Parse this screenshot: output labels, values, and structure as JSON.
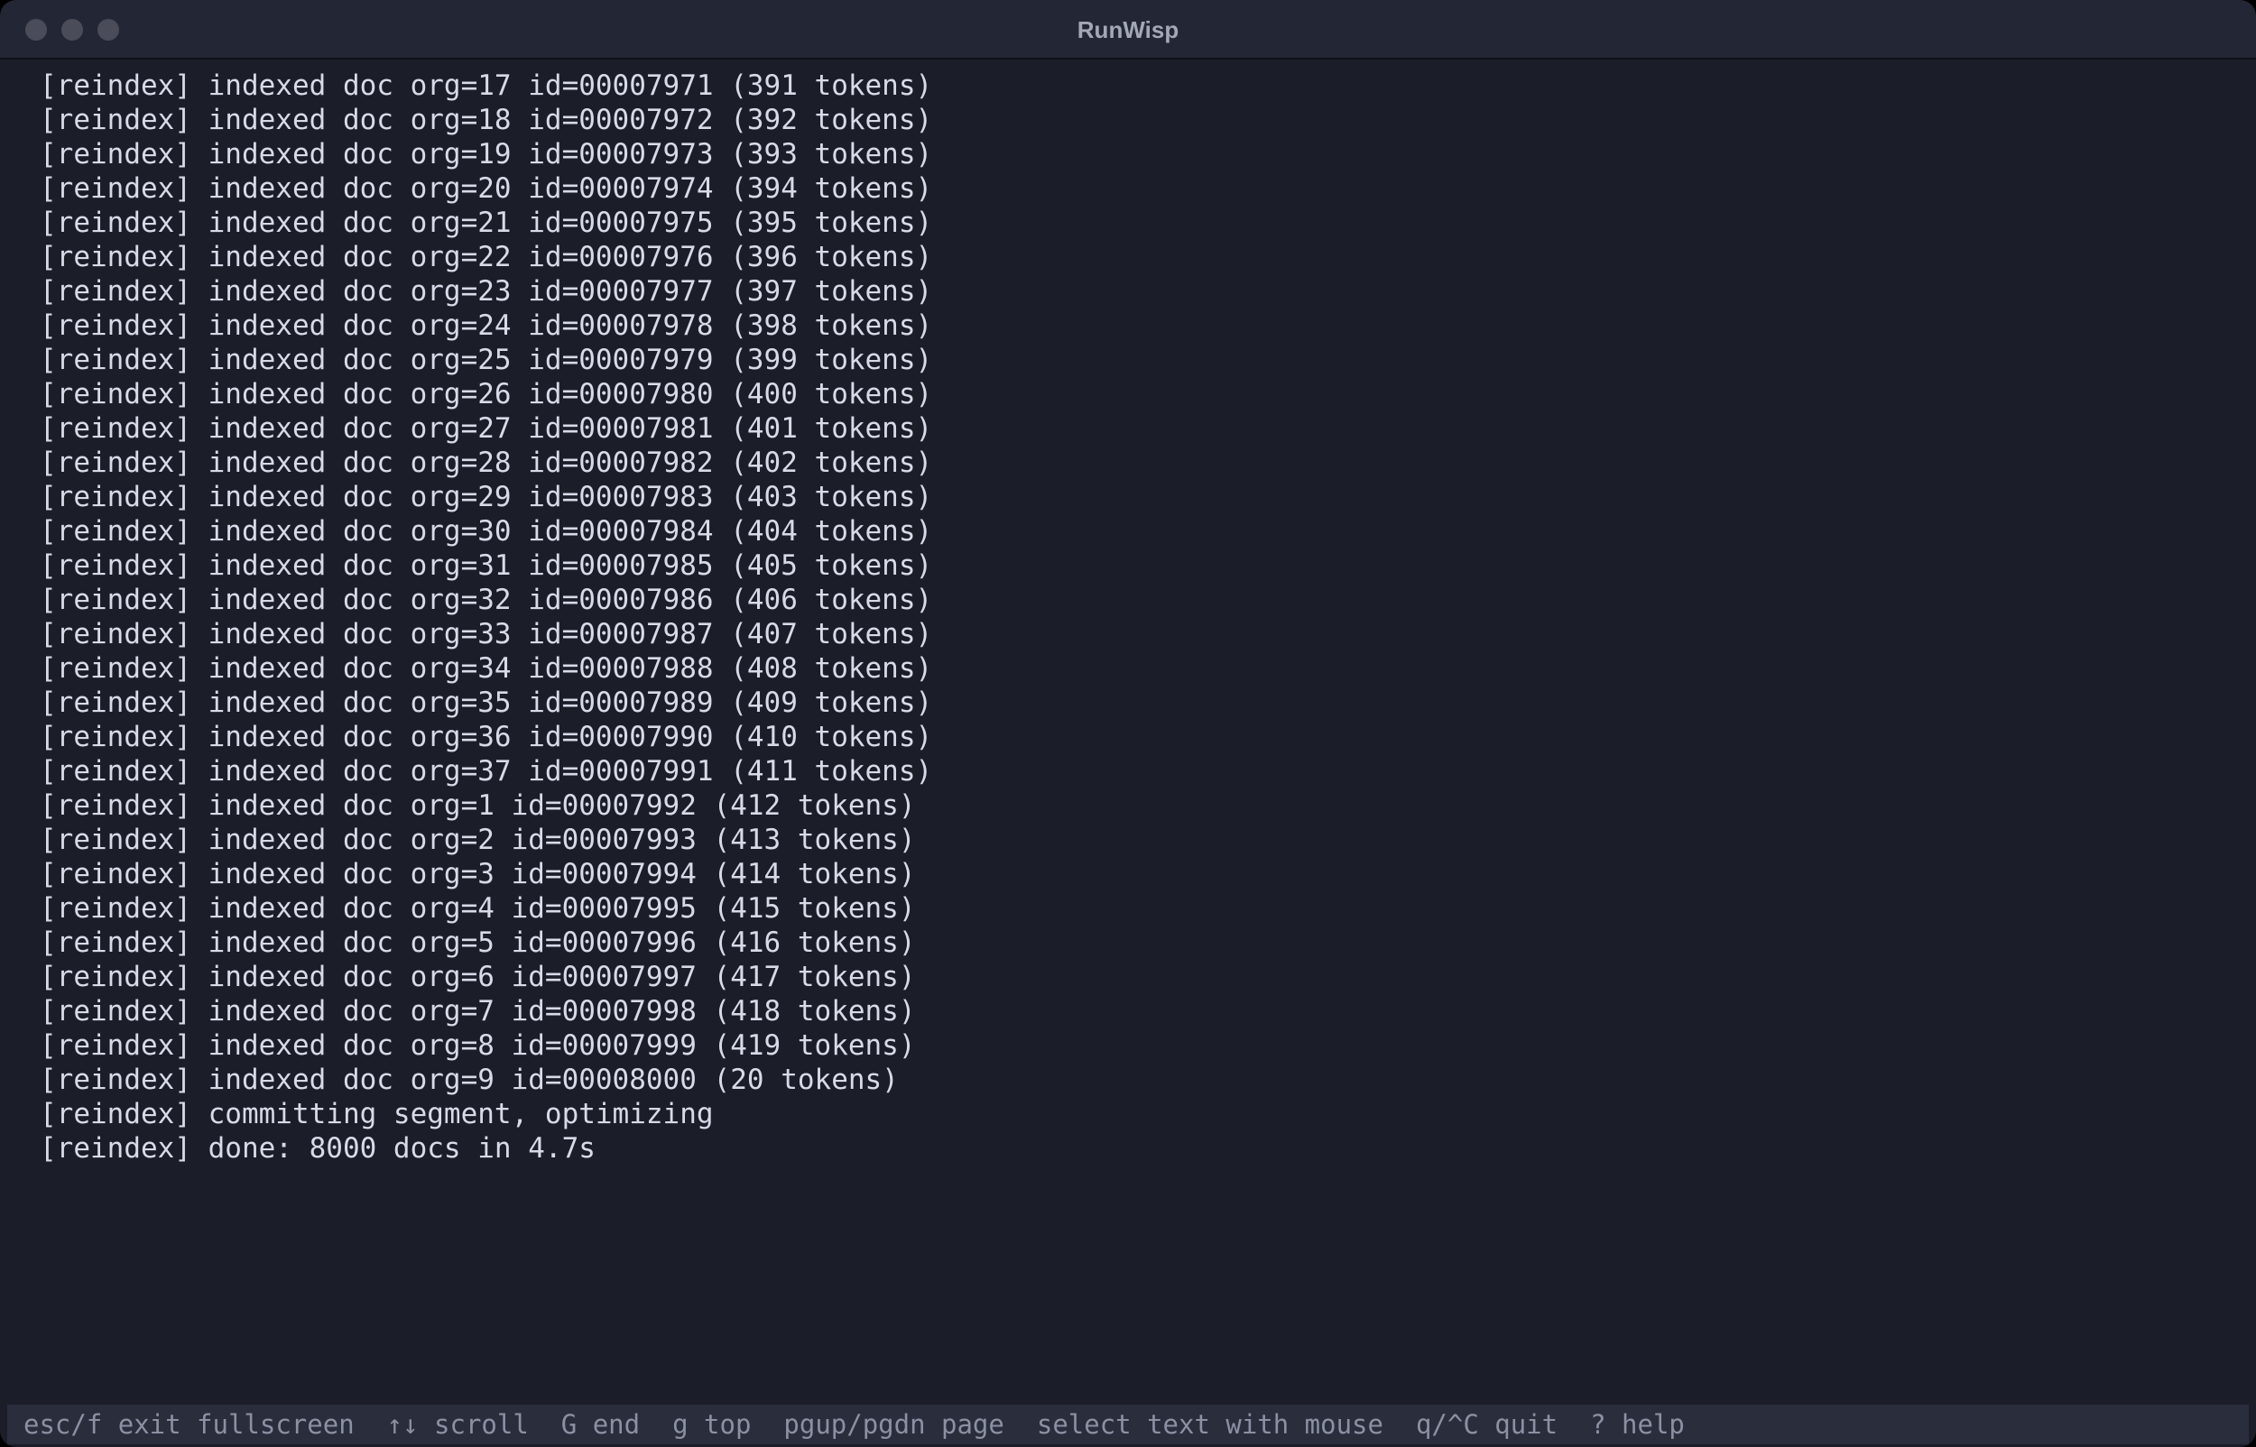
{
  "window": {
    "title": "RunWisp"
  },
  "log": {
    "lines": [
      "[reindex] indexed doc org=17 id=00007971 (391 tokens)",
      "[reindex] indexed doc org=18 id=00007972 (392 tokens)",
      "[reindex] indexed doc org=19 id=00007973 (393 tokens)",
      "[reindex] indexed doc org=20 id=00007974 (394 tokens)",
      "[reindex] indexed doc org=21 id=00007975 (395 tokens)",
      "[reindex] indexed doc org=22 id=00007976 (396 tokens)",
      "[reindex] indexed doc org=23 id=00007977 (397 tokens)",
      "[reindex] indexed doc org=24 id=00007978 (398 tokens)",
      "[reindex] indexed doc org=25 id=00007979 (399 tokens)",
      "[reindex] indexed doc org=26 id=00007980 (400 tokens)",
      "[reindex] indexed doc org=27 id=00007981 (401 tokens)",
      "[reindex] indexed doc org=28 id=00007982 (402 tokens)",
      "[reindex] indexed doc org=29 id=00007983 (403 tokens)",
      "[reindex] indexed doc org=30 id=00007984 (404 tokens)",
      "[reindex] indexed doc org=31 id=00007985 (405 tokens)",
      "[reindex] indexed doc org=32 id=00007986 (406 tokens)",
      "[reindex] indexed doc org=33 id=00007987 (407 tokens)",
      "[reindex] indexed doc org=34 id=00007988 (408 tokens)",
      "[reindex] indexed doc org=35 id=00007989 (409 tokens)",
      "[reindex] indexed doc org=36 id=00007990 (410 tokens)",
      "[reindex] indexed doc org=37 id=00007991 (411 tokens)",
      "[reindex] indexed doc org=1 id=00007992 (412 tokens)",
      "[reindex] indexed doc org=2 id=00007993 (413 tokens)",
      "[reindex] indexed doc org=3 id=00007994 (414 tokens)",
      "[reindex] indexed doc org=4 id=00007995 (415 tokens)",
      "[reindex] indexed doc org=5 id=00007996 (416 tokens)",
      "[reindex] indexed doc org=6 id=00007997 (417 tokens)",
      "[reindex] indexed doc org=7 id=00007998 (418 tokens)",
      "[reindex] indexed doc org=8 id=00007999 (419 tokens)",
      "[reindex] indexed doc org=9 id=00008000 (20 tokens)",
      "[reindex] committing segment, optimizing",
      "[reindex] done: 8000 docs in 4.7s"
    ]
  },
  "statusbar": {
    "hints": [
      {
        "name": "exit-fullscreen",
        "text": "esc/f exit fullscreen"
      },
      {
        "name": "scroll",
        "text": "↑↓ scroll"
      },
      {
        "name": "end",
        "text": "G end"
      },
      {
        "name": "top",
        "text": "g top"
      },
      {
        "name": "page",
        "text": "pgup/pgdn page"
      },
      {
        "name": "select-text",
        "text": "select text with mouse"
      },
      {
        "name": "quit",
        "text": "q/^C quit"
      },
      {
        "name": "help",
        "text": "? help"
      }
    ]
  },
  "colors": {
    "background": "#1b1d29",
    "titlebar": "#232634",
    "text": "#d7dbe8",
    "statusbar_bg": "#2a2d3c",
    "statusbar_text": "#8b90a3"
  }
}
